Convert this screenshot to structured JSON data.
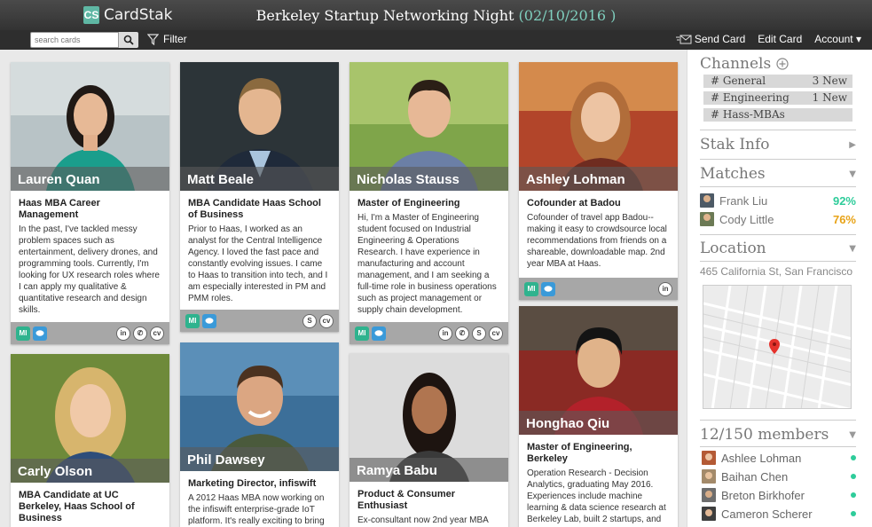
{
  "app": {
    "logo_mark": "CS",
    "logo_text": "CardStak"
  },
  "event": {
    "title": "Berkeley Startup Networking Night",
    "date": "(02/10/2016 )"
  },
  "toolbar": {
    "search_placeholder": "search cards",
    "filter_label": "Filter",
    "send_card_label": "Send Card",
    "edit_card_label": "Edit Card",
    "account_label": "Account ▾"
  },
  "cards": [
    {
      "name": "Lauren Quan",
      "title": "Haas MBA Career Management",
      "bio": "In the past, I've tackled messy problem spaces such as entertainment, delivery drones, and programming tools. Currently, I'm looking for UX research roles where I can apply my qualitative & quantitative research and design skills."
    },
    {
      "name": "Matt Beale",
      "title": "MBA Candidate Haas School of Business",
      "bio": "Prior to Haas, I worked as an analyst for the Central Intelligence Agency. I loved the fast pace and constantly evolving issues. I came to Haas to transition into tech, and I am especially interested in PM and PMM roles."
    },
    {
      "name": "Nicholas Stauss",
      "title": "Master of Engineering",
      "bio": "Hi, I'm a Master of Engineering student focused on Industrial Engineering & Operations Research. I have experience in manufacturing and account management, and I am seeking a full-time role in business operations such as project management or supply chain development."
    },
    {
      "name": "Ashley Lohman",
      "title": "Cofounder at Badou",
      "bio": "Cofounder of travel app Badou--making it easy to crowdsource local recommendations from friends on a shareable, downloadable map. 2nd year MBA at Haas."
    },
    {
      "name": "Carly Olson",
      "title": "MBA Candidate at UC Berkeley, Haas School of Business",
      "bio": ""
    },
    {
      "name": "Phil Dawsey",
      "title": "Marketing Director, infiswift",
      "bio": "A 2012 Haas MBA now working on the infiswift enterprise-grade IoT platform. It's really exciting to bring"
    },
    {
      "name": "Ramya Babu",
      "title": "Product & Consumer Enthusiast",
      "bio": "Ex-consultant now 2nd year MBA"
    },
    {
      "name": "Honghao Qiu",
      "title": "Master of Engineering, Berkeley",
      "bio": "Operation Research - Decision Analytics, graduating May 2016. Experiences include machine learning & data science research at Berkeley Lab, built 2 startups, and"
    }
  ],
  "footer_icons": {
    "chip1": "MI",
    "chip2": "…",
    "linkedin": "in",
    "cv": "cv"
  },
  "sidebar": {
    "channels_title": "Channels",
    "channels": [
      {
        "label": "# General",
        "new": "3 New"
      },
      {
        "label": "# Engineering",
        "new": "1 New"
      },
      {
        "label": "# Hass-MBAs",
        "new": ""
      }
    ],
    "stak_info_title": "Stak Info",
    "matches_title": "Matches",
    "matches": [
      {
        "name": "Frank Liu",
        "pct": "92%"
      },
      {
        "name": "Cody Little",
        "pct": "76%"
      }
    ],
    "location_title": "Location",
    "address": "465 California St, San Francisco",
    "members_title": "12/150 members",
    "members": [
      "Ashlee Lohman",
      "Baihan Chen",
      "Breton Birkhofer",
      "Cameron Scherer"
    ]
  },
  "colors": {
    "accent": "#2fb38e",
    "match_high": "#2ecc9a",
    "match_mid": "#e8a317",
    "chat_blue": "#3a9ad9"
  }
}
